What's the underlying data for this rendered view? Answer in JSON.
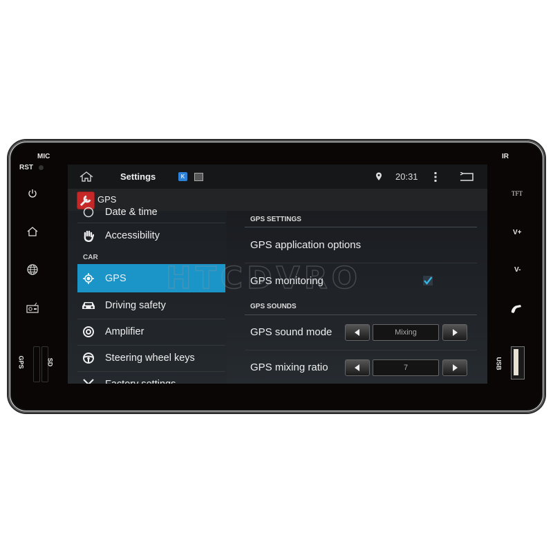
{
  "device": {
    "labels": {
      "mic": "MIC",
      "rst": "RST",
      "ir": "IR",
      "tft": "TFT",
      "v_plus": "V+",
      "v_minus": "V-",
      "gps_slot": "GPS",
      "sd_slot": "SD",
      "usb": "USB"
    },
    "left_buttons": [
      "power-icon",
      "home-icon",
      "globe-icon",
      "radio-icon"
    ],
    "right_buttons": [
      "phone-icon"
    ]
  },
  "actionbar": {
    "title": "Settings",
    "time": "20:31",
    "icons": [
      "home-icon",
      "app-k-icon",
      "image-icon",
      "location-pin-icon",
      "overflow-menu-icon",
      "back-icon"
    ]
  },
  "subbar": {
    "title": "GPS",
    "icon": "wrench-icon"
  },
  "left_menu": {
    "partial_top": "Date & time",
    "items_before": [
      {
        "label": "Accessibility",
        "icon": "hand-icon"
      }
    ],
    "category": "CAR",
    "items": [
      {
        "label": "GPS",
        "icon": "gps-target-icon",
        "selected": true
      },
      {
        "label": "Driving safety",
        "icon": "car-icon",
        "selected": false
      },
      {
        "label": "Amplifier",
        "icon": "amplifier-icon",
        "selected": false
      },
      {
        "label": "Steering wheel keys",
        "icon": "steering-wheel-icon",
        "selected": false
      }
    ],
    "partial_bottom": "Factory settings"
  },
  "right_pane": {
    "section1": "GPS SETTINGS",
    "app_options": "GPS application options",
    "monitoring": {
      "label": "GPS monitoring",
      "checked": true
    },
    "section2": "GPS SOUNDS",
    "sound_mode": {
      "label": "GPS sound mode",
      "value": "Mixing"
    },
    "mixing_ratio": {
      "label": "GPS mixing ratio",
      "value": "7"
    }
  },
  "watermark": "HTCDVRO",
  "colors": {
    "accent": "#1b95c8",
    "check": "#33b5e5",
    "bezel": "#0b0606"
  }
}
